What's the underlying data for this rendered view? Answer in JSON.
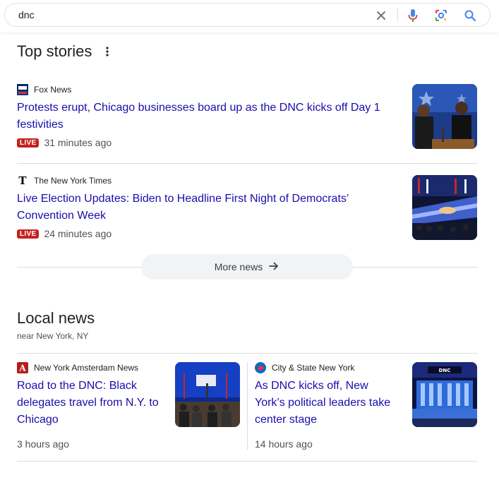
{
  "search": {
    "query": "dnc"
  },
  "top_stories": {
    "title": "Top stories",
    "items": [
      {
        "source": "Fox News",
        "headline_line1": "Protests erupt, Chicago businesses board up as the DNC kicks off Day 1",
        "headline_line2": "festivities",
        "live_label": "LIVE",
        "time": "31 minutes ago"
      },
      {
        "source": "The New York Times",
        "headline_line1": "Live Election Updates: Biden to Headline First Night of Democrats’",
        "headline_line2": "Convention Week",
        "live_label": "LIVE",
        "time": "24 minutes ago"
      }
    ],
    "more_label": "More news"
  },
  "local_news": {
    "title": "Local news",
    "subtitle": "near New York, NY",
    "items": [
      {
        "source": "New York Amsterdam News",
        "headline_lines": [
          "Road to the DNC: Black",
          "delegates travel from N.Y. to",
          "Chicago"
        ],
        "time": "3 hours ago"
      },
      {
        "source": "City & State New York",
        "headline_lines": [
          "As DNC kicks off, New",
          "York’s political leaders take",
          "center stage"
        ],
        "time": "14 hours ago"
      }
    ]
  },
  "icons": {
    "clear": "close-icon",
    "voice": "microphone-icon",
    "lens": "camera-lens-icon",
    "search": "search-icon",
    "menu": "more-vert-icon",
    "arrow": "arrow-right-icon"
  },
  "colors": {
    "link": "#1a0dab",
    "live_badge": "#c5221f",
    "divider": "#dadce0",
    "more_button_bg": "#f1f3f4"
  }
}
